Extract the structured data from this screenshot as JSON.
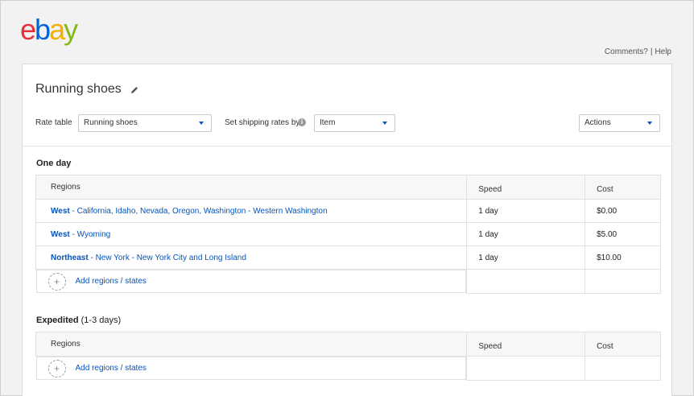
{
  "logo": {
    "letters": [
      "e",
      "b",
      "a",
      "y"
    ]
  },
  "top_links": {
    "comments": "Comments?",
    "separator": "|",
    "help": "Help"
  },
  "page": {
    "title": "Running shoes"
  },
  "controls": {
    "rate_table_label": "Rate table",
    "rate_table_value": "Running shoes",
    "shipping_by_label": "Set shipping rates by",
    "shipping_by_value": "Item",
    "actions_label": "Actions"
  },
  "sections": [
    {
      "title": "One day",
      "subtitle": "",
      "headers": {
        "regions": "Regions",
        "speed": "Speed",
        "cost": "Cost"
      },
      "rows": [
        {
          "region": "West",
          "detail": " - California, Idaho, Nevada, Oregon, Washington - Western Washington",
          "speed": "1 day",
          "cost": "$0.00"
        },
        {
          "region": "West",
          "detail": " - Wyoming",
          "speed": "1 day",
          "cost": "$5.00"
        },
        {
          "region": "Northeast",
          "detail": " - New York - New York City and Long Island",
          "speed": "1 day",
          "cost": "$10.00"
        }
      ],
      "add_label": "Add regions / states"
    },
    {
      "title": "Expedited",
      "subtitle": " (1-3 days)",
      "headers": {
        "regions": "Regions",
        "speed": "Speed",
        "cost": "Cost"
      },
      "rows": [],
      "add_label": "Add regions / states"
    }
  ],
  "colors": {
    "link": "#0654ba",
    "logo_e": "#e53238",
    "logo_b": "#0064d2",
    "logo_a": "#f5af02",
    "logo_y": "#86b817"
  }
}
